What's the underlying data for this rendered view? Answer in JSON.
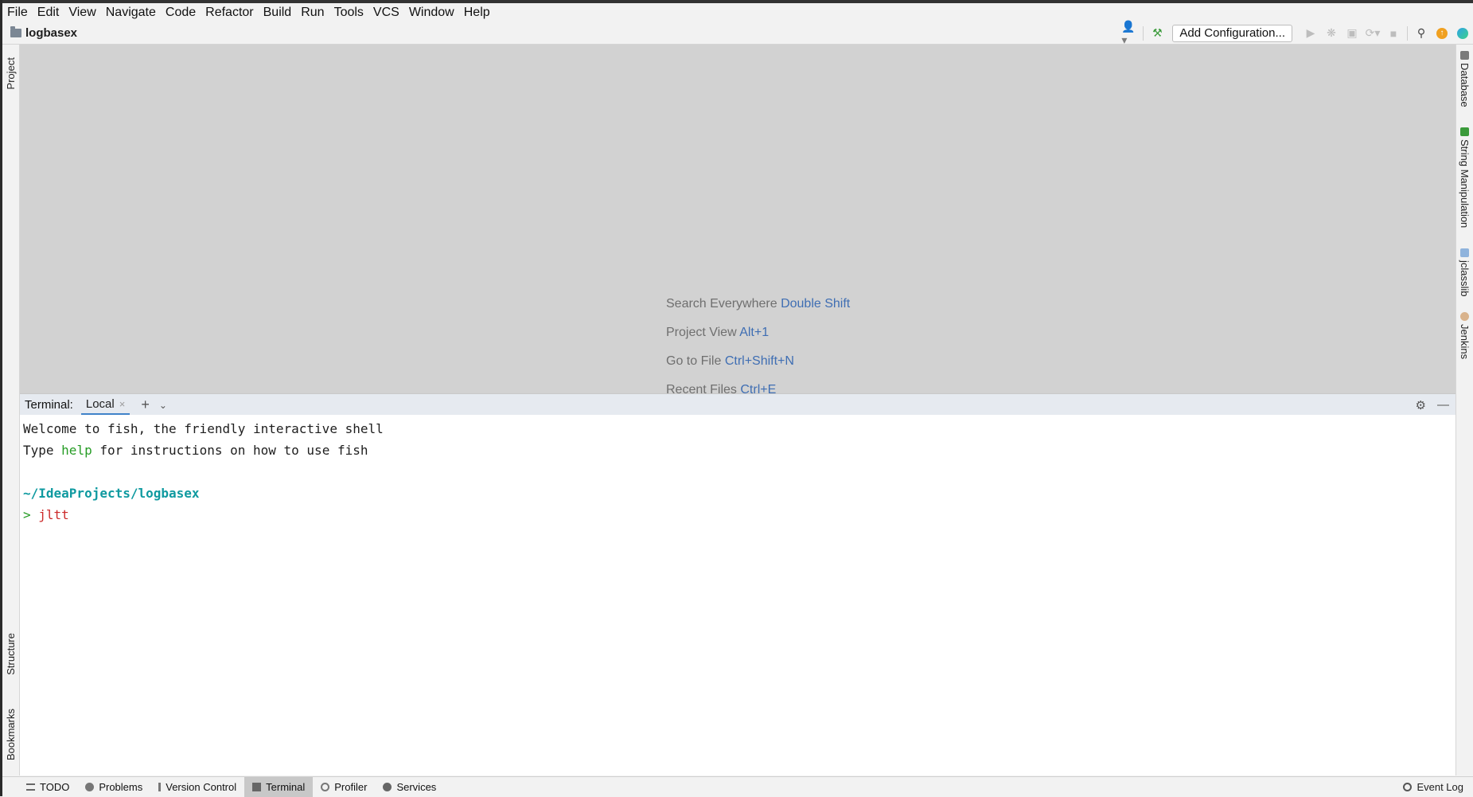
{
  "menu": [
    "File",
    "Edit",
    "View",
    "Navigate",
    "Code",
    "Refactor",
    "Build",
    "Run",
    "Tools",
    "VCS",
    "Window",
    "Help"
  ],
  "navbar": {
    "project_name": "logbasex",
    "add_configuration": "Add Configuration..."
  },
  "left_tools": {
    "project": "Project",
    "structure": "Structure",
    "bookmarks": "Bookmarks"
  },
  "right_tools": {
    "database": "Database",
    "string_manipulation": "String Manipulation",
    "jclasslib": "jclasslib",
    "jenkins": "Jenkins"
  },
  "hints": [
    {
      "label": "Search Everywhere",
      "key": "Double Shift"
    },
    {
      "label": "Project View",
      "key": "Alt+1"
    },
    {
      "label": "Go to File",
      "key": "Ctrl+Shift+N"
    },
    {
      "label": "Recent Files",
      "key": "Ctrl+E"
    }
  ],
  "terminal": {
    "title": "Terminal:",
    "tab": "Local",
    "lines": {
      "welcome": "Welcome to fish, the friendly interactive shell",
      "type_prefix": "Type ",
      "help_word": "help",
      "type_suffix": " for instructions on how to use fish",
      "path": "~/IdeaProjects/logbasex",
      "prompt": ">",
      "command": "jltt"
    }
  },
  "statusbar": {
    "todo": "TODO",
    "problems": "Problems",
    "version_control": "Version Control",
    "terminal": "Terminal",
    "profiler": "Profiler",
    "services": "Services",
    "event_log": "Event Log"
  },
  "colors": {
    "accent": "#4083c9",
    "hint_key": "#3f6eb3",
    "editor_bg": "#d2d2d2",
    "terminal_bg": "#ffffff"
  }
}
